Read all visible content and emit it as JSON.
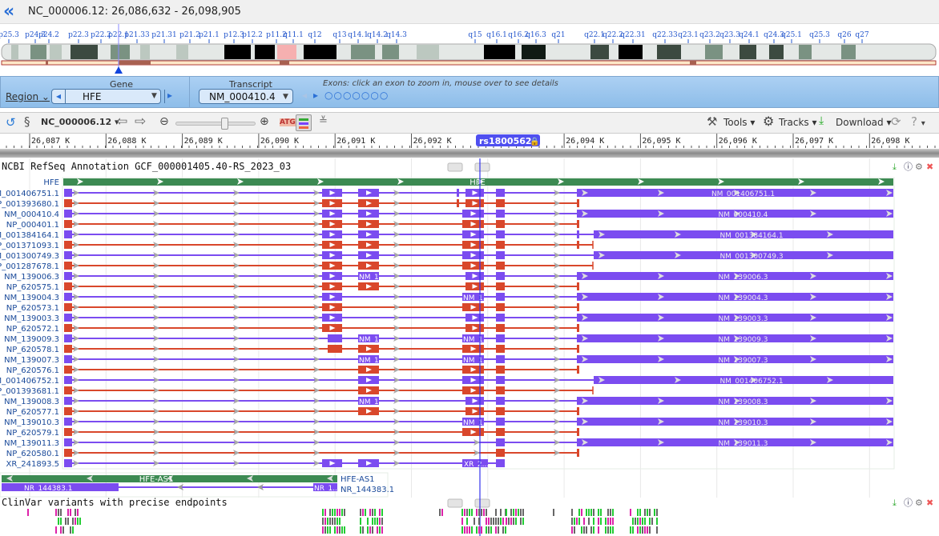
{
  "header": {
    "title": "NC_000006.12:  26,086,632 - 26,098,905",
    "back_icon": "double-chevron-left-icon"
  },
  "ideogram": {
    "bands": [
      "p25.3",
      "p24.3",
      "p24.2",
      "p22.3",
      "p22.2",
      "p22.1",
      "p21.33",
      "p21.31",
      "p21.2",
      "p21.1",
      "p12.3",
      "p12.2",
      "p11.2",
      "q11.1",
      "q12",
      "q13",
      "q14.1",
      "q14.2",
      "q14.3",
      "q15",
      "q16.1",
      "q16.2",
      "q16.3",
      "q21",
      "q22.1",
      "q22.2",
      "q22.31",
      "q22.33",
      "q23.1",
      "q23.2",
      "q23.3",
      "q24.1",
      "q24.3",
      "q25.1",
      "q25.3",
      "q26",
      "q27"
    ]
  },
  "panel": {
    "region_label": "Region",
    "gene_label": "Gene",
    "gene_value": "HFE",
    "transcript_label": "Transcript",
    "transcript_value": "NM_000410.4",
    "exons_hint": "Exons: click an exon to zoom in, mouse over to see details"
  },
  "toolbar": {
    "sequence": "NC_000006.12",
    "tools": "Tools",
    "tracks": "Tracks",
    "download": "Download"
  },
  "ruler": {
    "ticks": [
      "26,087 K",
      "26,088 K",
      "26,089 K",
      "26,090 K",
      "26,091 K",
      "26,092 K",
      "26,093 K",
      "26,094 K",
      "26,095 K",
      "26,096 K",
      "26,097 K",
      "26,098 K"
    ],
    "marker": "rs1800562"
  },
  "refseq_track": {
    "title": "NCBI RefSeq Annotation GCF_000001405.40-RS_2023_03",
    "gene": "HFE",
    "transcripts": [
      "NM_001406751.1",
      "NP_001393680.1",
      "NM_000410.4",
      "NP_000401.1",
      "NM_001384164.1",
      "NP_001371093.1",
      "NM_001300749.3",
      "NP_001287678.1",
      "NM_139006.3",
      "NP_620575.1",
      "NM_139004.3",
      "NP_620573.1",
      "NM_139003.3",
      "NP_620572.1",
      "NM_139009.3",
      "NP_620578.1",
      "NM_139007.3",
      "NP_620576.1",
      "NM_001406752.1",
      "NP_001393681.1",
      "NM_139008.3",
      "NP_620577.1",
      "NM_139010.3",
      "NP_620579.1",
      "NM_139011.3",
      "NP_620580.1",
      "XR_241893.5"
    ],
    "antisense_gene": "HFE-AS1",
    "antisense_transcript": "NR_144383.1",
    "truncated_nm": "NM_1...",
    "truncated_xr": "XR_2...",
    "truncated_nr": "NR_1..."
  },
  "clinvar_track": {
    "title": "ClinVar variants with precise endpoints"
  },
  "colors": {
    "mrna": "#7b4cf0",
    "protein": "#d9472b",
    "gene": "#3c8a52",
    "marker": "#3333ee",
    "accent": "#2a6fd6"
  }
}
